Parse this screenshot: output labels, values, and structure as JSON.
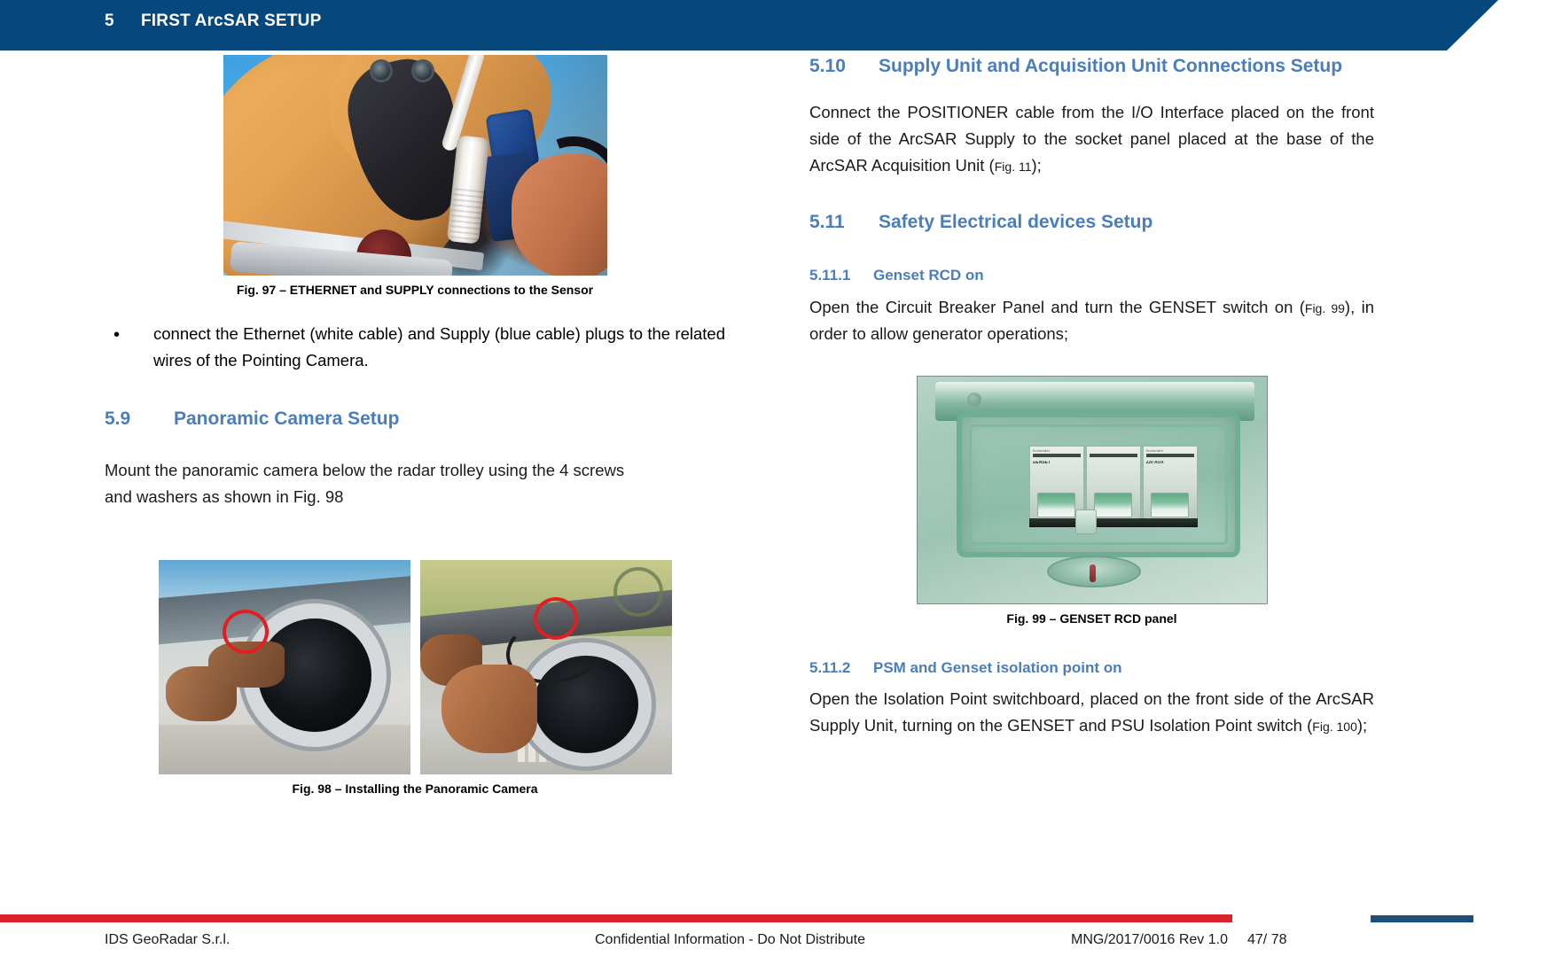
{
  "header": {
    "chapter_number": "5",
    "chapter_title": "FIRST ArcSAR SETUP"
  },
  "left_column": {
    "figure_97": {
      "caption": "Fig. 97 – ETHERNET and SUPPLY connections to the Sensor",
      "alt": "photo-ethernet-supply-connections"
    },
    "bullet": {
      "marker": "•",
      "text": "connect the Ethernet (white cable) and Supply (blue cable) plugs to the related wires of the Pointing Camera."
    },
    "section_5_9": {
      "number": "5.9",
      "title": "Panoramic Camera Setup",
      "body": "Mount the panoramic camera below the radar trolley using the 4 screws and washers as shown in Fig. 98"
    },
    "figure_98": {
      "caption": "Fig. 98 – Installing the Panoramic Camera",
      "alt_left": "photo-panoramic-camera-mounting-left",
      "alt_right": "photo-panoramic-camera-mounting-right"
    }
  },
  "right_column": {
    "section_5_10": {
      "number": "5.10",
      "title": "Supply Unit and Acquisition Unit Connections Setup",
      "body_part1": "Connect the POSITIONER cable from the I/O Interface placed on the front side of the ArcSAR Supply to the socket panel placed at the base of the ArcSAR Acquisition Unit (",
      "figref": "Fig. 11",
      "body_part2": ");"
    },
    "section_5_11": {
      "number": "5.11",
      "title": "Safety Electrical devices Setup"
    },
    "section_5_11_1": {
      "number": "5.11.1",
      "title": "Genset RCD on",
      "body_part1": "Open the Circuit Breaker Panel and turn the GENSET switch on (",
      "figref": "Fig. 99",
      "body_part2": "), in order to allow generator operations;"
    },
    "figure_99": {
      "caption": "Fig. 99 – GENSET RCD panel",
      "alt": "photo-genset-rcd-panel",
      "breaker_labels": [
        "GENSET",
        "",
        "220 AUX"
      ]
    },
    "section_5_11_2": {
      "number": "5.11.2",
      "title": "PSM and Genset isolation point on",
      "body_part1": "Open the Isolation Point switchboard, placed on the front side of the ArcSAR Supply Unit, turning on the GENSET and PSU Isolation Point switch (",
      "figref": "Fig. 100",
      "body_part2": ");"
    }
  },
  "footer": {
    "company": "IDS GeoRadar S.r.l.",
    "confidentiality": "Confidential Information - Do Not Distribute",
    "doc_id": "MNG/2017/0016  Rev 1.0",
    "page": "47/ 78"
  },
  "colors": {
    "header_blue": "#06477c",
    "heading_blue": "#4a7ebb",
    "footer_red": "#d9222a",
    "footer_blue": "#1d4f7c"
  }
}
